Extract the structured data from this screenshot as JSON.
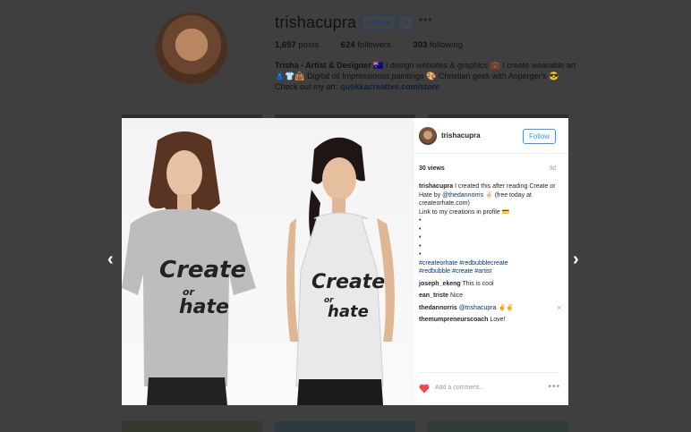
{
  "profile": {
    "username": "trishacupra",
    "follow_label": "Follow",
    "dropdown_glyph": "▾",
    "more_glyph": "•••",
    "stats": {
      "posts_count": "1,657",
      "posts_label": "posts",
      "followers_count": "624",
      "followers_label": "followers",
      "following_count": "303",
      "following_label": "following"
    },
    "bio_name": "Trisha - Artist & Designer",
    "bio_line1": "🇦🇺 I design websites & graphics 💼 I create wearable art",
    "bio_line2": "👗👕👜 Digital oil Impressionist paintings 🎨 Christian geek with Asperger's 😎",
    "bio_line3_prefix": "Check out my art:",
    "bio_link": "quokkacreative.com/store"
  },
  "nav": {
    "prev_glyph": "‹",
    "next_glyph": "›"
  },
  "post": {
    "photo_text_line1": "Create",
    "photo_text_line2": "or",
    "photo_text_line3": "hate",
    "username": "trishacupra",
    "follow_label": "Follow",
    "views": "30 views",
    "age": "3d",
    "caption_user": "trishacupra",
    "caption_text": "I created this after reading Create or Hate by",
    "caption_mention": "@thedannorris",
    "caption_text2": "✌🏻 (free today at createorhate.com)",
    "caption_text3": "Link to my creations in profile 💳",
    "bullets": [
      "•",
      "•",
      "•",
      "•",
      "•"
    ],
    "hashtags_line1": "#createorhate #redbubblecreate",
    "hashtags_line2": "#redbubble #create #artist",
    "comments": [
      {
        "user": "joseph_ekeng",
        "text": "This is cool"
      },
      {
        "user": "ean_triste",
        "text": "Nice"
      },
      {
        "user": "thedannorris",
        "mention": "@trishacupra",
        "text": "✌✌"
      },
      {
        "user": "themumpreneurscoach",
        "text": "Love!"
      }
    ],
    "add_comment_placeholder": "Add a comment...",
    "more_glyph": "•••",
    "delete_glyph": "✕"
  },
  "colors": {
    "accent": "#3897f0",
    "heart": "#ed4956",
    "overlay": "#3f3f3f"
  }
}
